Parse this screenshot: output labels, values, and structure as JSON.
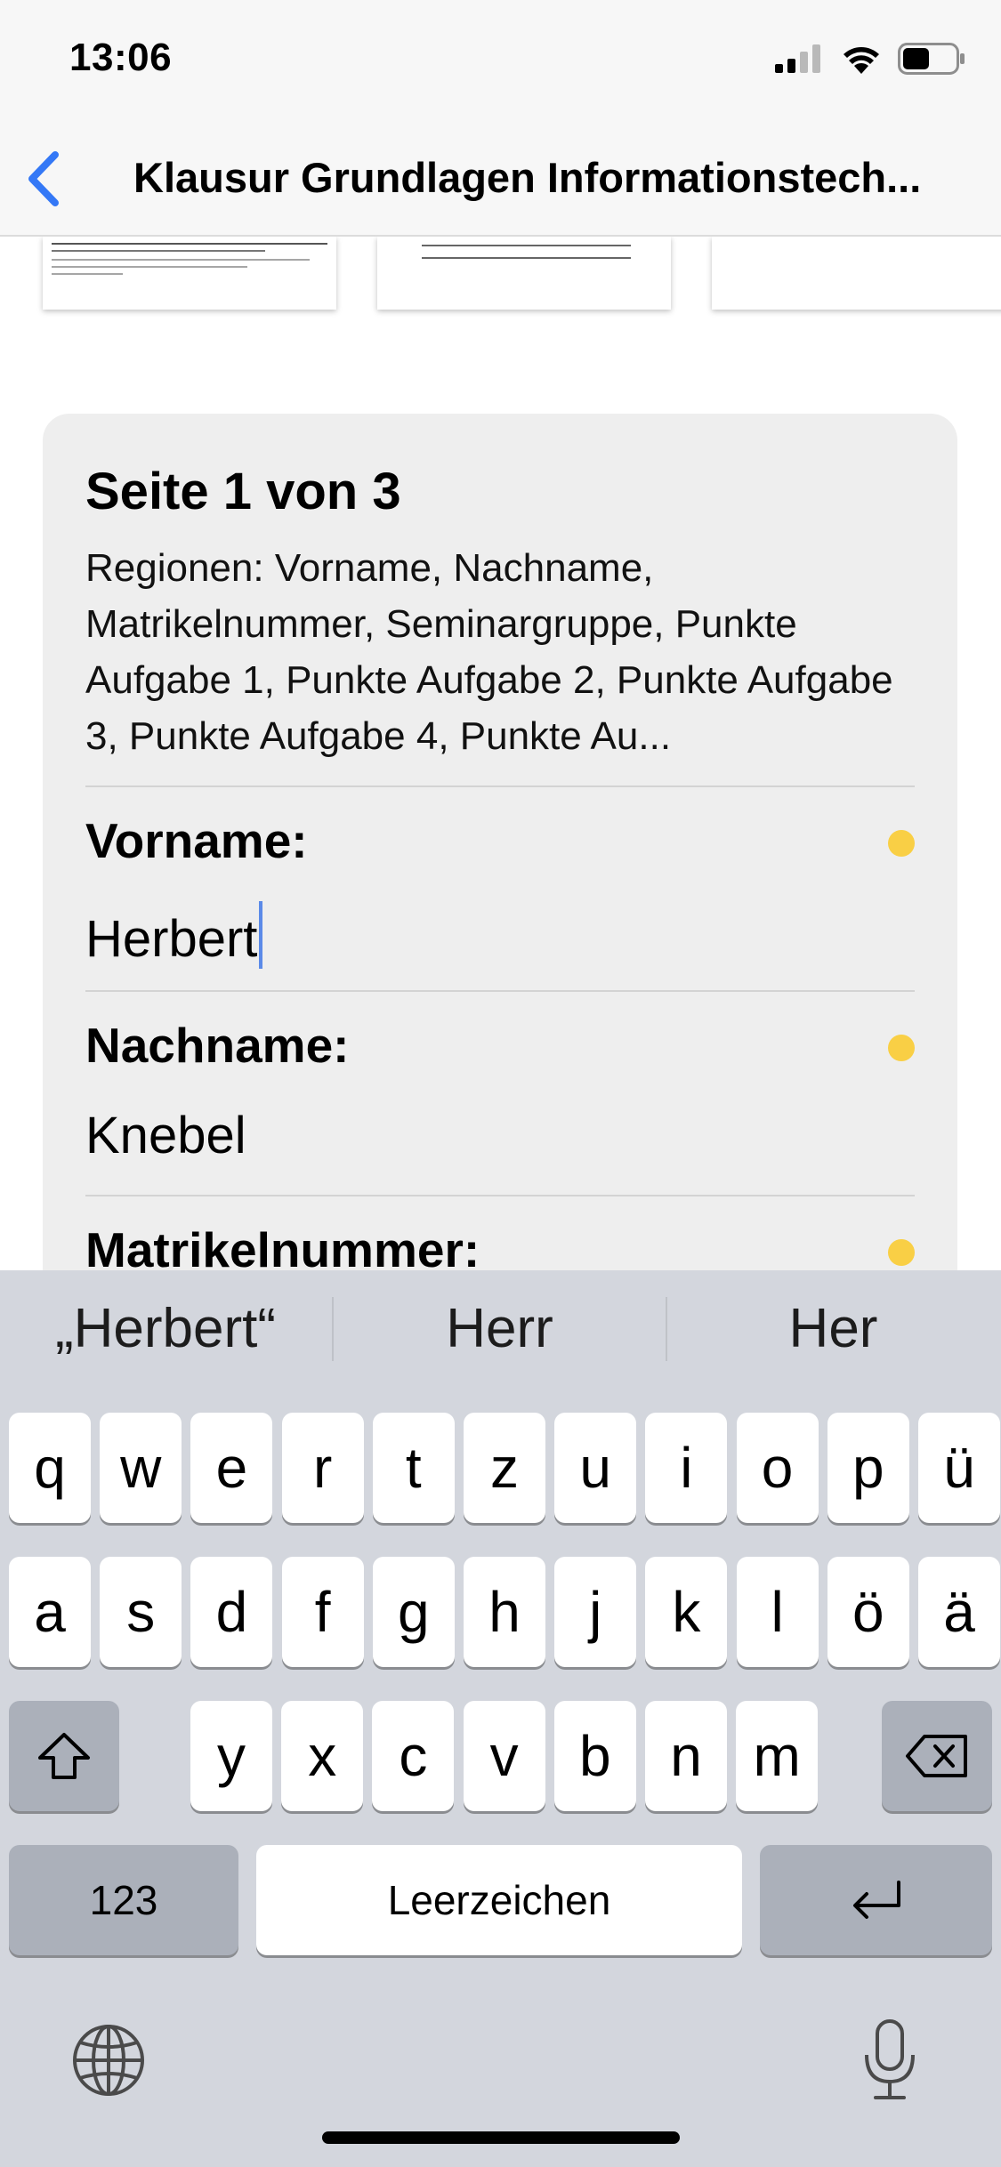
{
  "status_bar": {
    "time": "13:06",
    "battery_level": 0.5
  },
  "nav": {
    "title": "Klausur Grundlagen Informationstech...",
    "back_icon": "chevron-left-icon"
  },
  "card": {
    "heading": "Seite 1 von 3",
    "regions": "Regionen: Vorname, Nachname, Matrikelnummer, Seminargruppe, Punkte Aufgabe 1, Punkte Aufgabe 2, Punkte Aufgabe 3, Punkte Aufgabe 4, Punkte Au...",
    "fields": [
      {
        "label": "Vorname:",
        "value": "Herbert",
        "status_color": "#f9cf45"
      },
      {
        "label": "Nachname:",
        "value": "Knebel",
        "status_color": "#f9cf45"
      },
      {
        "label": "Matrikelnummer:",
        "value": "",
        "status_color": "#f9cf45"
      }
    ]
  },
  "keyboard": {
    "suggestions": [
      "„Herbert“",
      "Herr",
      "Her"
    ],
    "row1": [
      "q",
      "w",
      "e",
      "r",
      "t",
      "z",
      "u",
      "i",
      "o",
      "p",
      "ü"
    ],
    "row2": [
      "a",
      "s",
      "d",
      "f",
      "g",
      "h",
      "j",
      "k",
      "l",
      "ö",
      "ä"
    ],
    "row3": [
      "y",
      "x",
      "c",
      "v",
      "b",
      "n",
      "m"
    ],
    "numbers_key": "123",
    "space_key": "Leerzeichen",
    "icons": {
      "shift": "shift-icon",
      "delete": "delete-icon",
      "return": "return-icon",
      "globe": "globe-icon",
      "mic": "microphone-icon"
    }
  },
  "colors": {
    "accent": "#3478f6",
    "status_dot": "#f9cf45",
    "caret": "#5b8ae8"
  }
}
